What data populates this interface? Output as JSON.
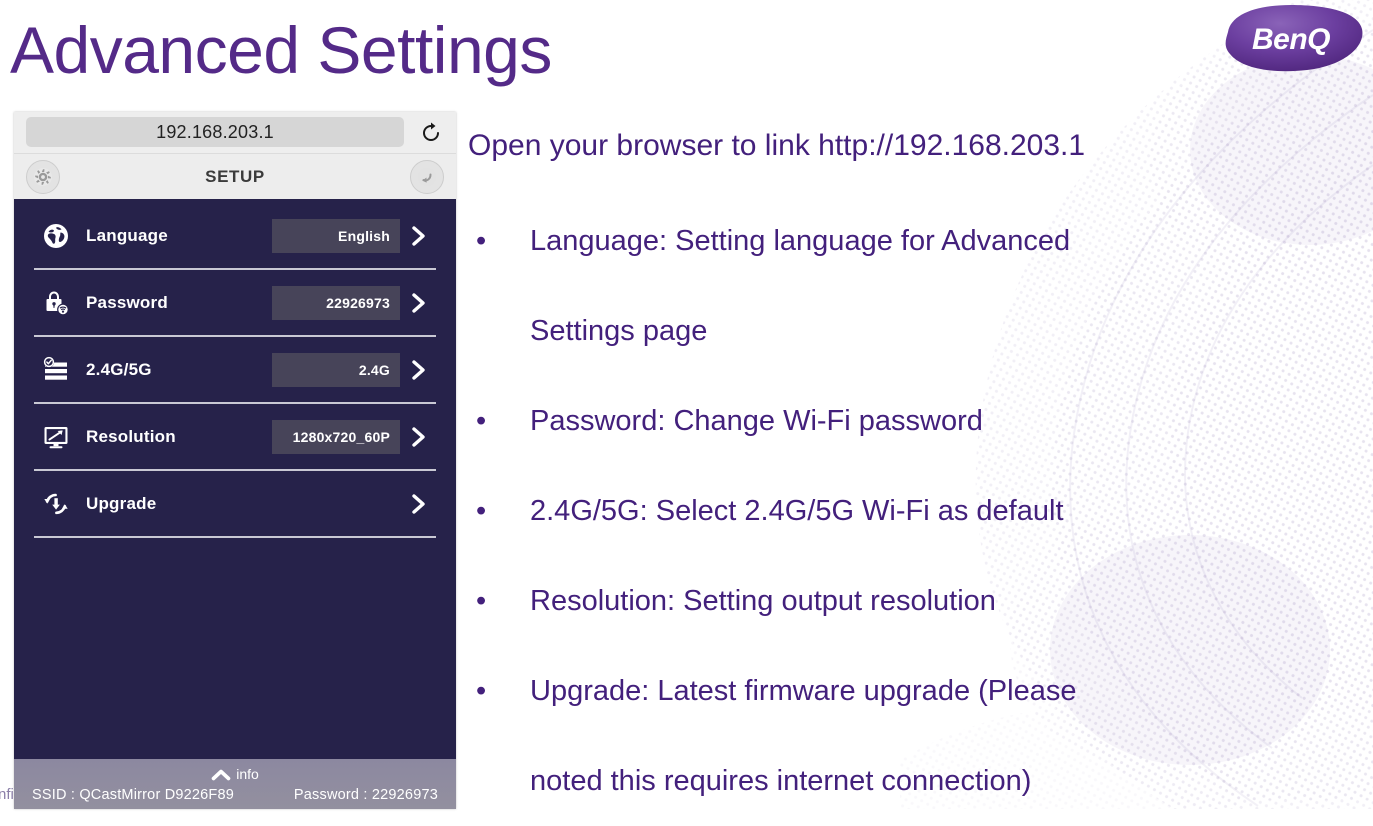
{
  "slide": {
    "title": "Advanced Settings",
    "brand_logo_text": "BenQ",
    "accent_color": "#542a88",
    "body_text_color": "#43207c",
    "clipped_background_text": "nfi"
  },
  "device_screenshot": {
    "browser": {
      "url": "192.168.203.1",
      "reload_icon": "reload-icon"
    },
    "header": {
      "title": "SETUP",
      "left_icon": "gear-icon",
      "right_icon": "back-arrow-icon"
    },
    "settings_rows": [
      {
        "icon": "globe-icon",
        "label": "Language",
        "value": "English",
        "has_value": true,
        "chevron": "chevron-right-icon"
      },
      {
        "icon": "lock-wifi-icon",
        "label": "Password",
        "value": "22926973",
        "has_value": true,
        "chevron": "chevron-right-icon"
      },
      {
        "icon": "band-list-icon",
        "label": "2.4G/5G",
        "value": "2.4G",
        "has_value": true,
        "chevron": "chevron-right-icon"
      },
      {
        "icon": "monitor-icon",
        "label": "Resolution",
        "value": "1280x720_60P",
        "has_value": true,
        "chevron": "chevron-right-icon"
      },
      {
        "icon": "upgrade-icon",
        "label": "Upgrade",
        "value": "",
        "has_value": false,
        "chevron": "chevron-right-icon"
      }
    ],
    "info_bar": {
      "toggle_label": "info",
      "toggle_icon": "chevron-up-icon",
      "ssid_label": "SSID : QCastMirror D9226F89",
      "password_label": "Password : 22926973"
    },
    "panel_color": "#26224a",
    "value_box_color": "#474459"
  },
  "content": {
    "lead_line": "Open your browser to link http://192.168.203.1",
    "bullet_marker": "•",
    "bullets": [
      "Language:  Setting language for Advanced\nSettings page",
      "Password: Change Wi-Fi password",
      "2.4G/5G: Select 2.4G/5G Wi-Fi as default",
      "Resolution: Setting output resolution",
      "Upgrade: Latest firmware upgrade (Please\nnoted this requires internet connection)"
    ]
  }
}
